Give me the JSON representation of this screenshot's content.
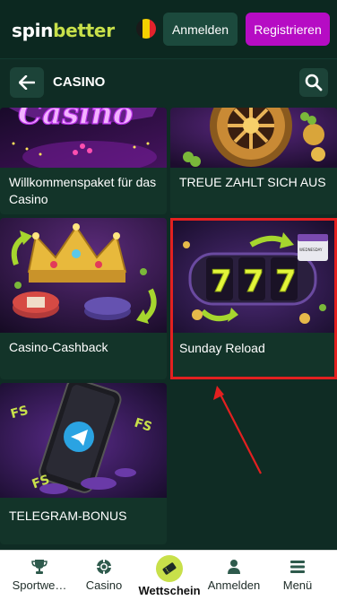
{
  "header": {
    "logo_part1": "spin",
    "logo_part2": "better",
    "login_label": "Anmelden",
    "register_label": "Registrieren"
  },
  "section": {
    "title": "CASINO"
  },
  "cards": [
    {
      "title": "Willkommenspaket für das Casino"
    },
    {
      "title": "TREUE ZAHLT SICH AUS"
    },
    {
      "title": "Casino-Cashback"
    },
    {
      "title": "Sunday Reload"
    },
    {
      "title": "TELEGRAM-BONUS"
    }
  ],
  "card_art": {
    "casino_sign": "Casino",
    "slot_digit": "7",
    "calendar_day": "WEDNESDAY",
    "fs_badge": "FS"
  },
  "bottom_nav": {
    "sports": "Sportwe…",
    "casino": "Casino",
    "bets": "Wettschein",
    "login": "Anmelden",
    "menu": "Menü"
  },
  "colors": {
    "brand_green": "#c8e04a",
    "register_purple": "#b60cc4",
    "background": "#0f2c24",
    "card": "#133429",
    "highlight_red": "#e32020"
  }
}
